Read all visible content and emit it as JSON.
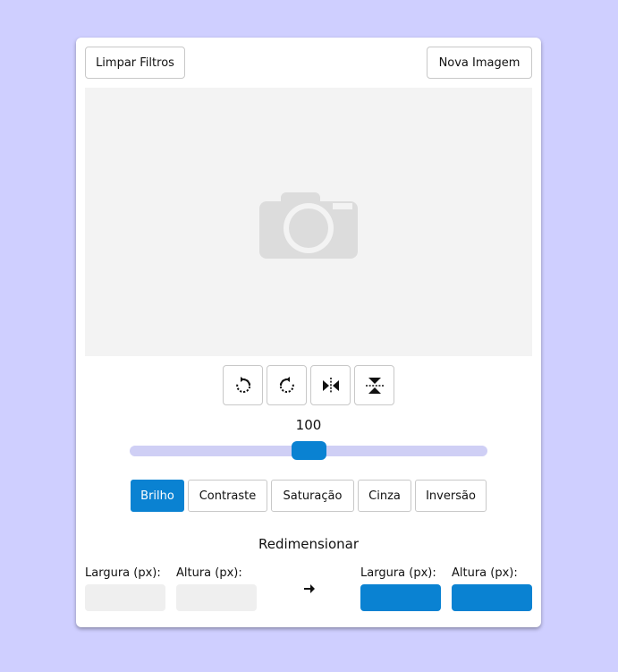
{
  "header": {
    "clear_filters_label": "Limpar Filtros",
    "new_image_label": "Nova Imagem"
  },
  "preview": {
    "icon": "camera-icon"
  },
  "tools": [
    {
      "name": "rotate-right-icon"
    },
    {
      "name": "rotate-left-icon"
    },
    {
      "name": "flip-horizontal-icon"
    },
    {
      "name": "flip-vertical-icon"
    }
  ],
  "slider": {
    "value": "100",
    "fraction": 0.5
  },
  "filters": [
    {
      "label": "Brilho",
      "active": true
    },
    {
      "label": "Contraste",
      "active": false
    },
    {
      "label": "Saturação",
      "active": false
    },
    {
      "label": "Cinza",
      "active": false
    },
    {
      "label": "Inversão",
      "active": false
    }
  ],
  "resize": {
    "title": "Redimensionar",
    "width_label": "Largura (px):",
    "height_label": "Altura (px):",
    "width_value": "",
    "height_value": "",
    "new_width_label": "Largura (px):",
    "new_height_label": "Altura (px):",
    "new_width_value": "",
    "new_height_value": ""
  },
  "colors": {
    "background": "#cfcfff",
    "accent": "#0a82d2",
    "slider_track": "#cfcff5"
  }
}
